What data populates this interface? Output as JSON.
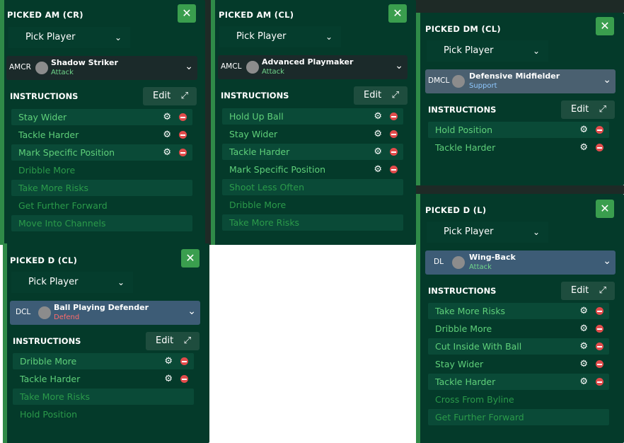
{
  "panels": {
    "amcr": {
      "title": "PICKED AM (CR)",
      "close": "✕",
      "pick": "Pick Player",
      "role": {
        "pos": "AMCR",
        "name": "Shadow Striker",
        "duty": "Attack",
        "duty_color": "#6fd68b",
        "bg": "#1b2a2a"
      },
      "instructions_title": "INSTRUCTIONS",
      "edit": "Edit",
      "rows": [
        {
          "label": "Stay Wider",
          "active": true
        },
        {
          "label": "Tackle Harder",
          "active": true
        },
        {
          "label": "Mark Specific Position",
          "active": true
        },
        {
          "label": "Dribble More",
          "active": false
        },
        {
          "label": "Take More Risks",
          "active": false
        },
        {
          "label": "Get Further Forward",
          "active": false
        },
        {
          "label": "Move Into Channels",
          "active": false
        }
      ]
    },
    "amcl": {
      "title": "PICKED AM (CL)",
      "close": "✕",
      "pick": "Pick Player",
      "role": {
        "pos": "AMCL",
        "name": "Advanced Playmaker",
        "duty": "Attack",
        "duty_color": "#6fd68b",
        "bg": "#1b2a2a"
      },
      "instructions_title": "INSTRUCTIONS",
      "edit": "Edit",
      "rows": [
        {
          "label": "Hold Up Ball",
          "active": true
        },
        {
          "label": "Stay Wider",
          "active": true
        },
        {
          "label": "Tackle Harder",
          "active": true
        },
        {
          "label": "Mark Specific Position",
          "active": true
        },
        {
          "label": "Shoot Less Often",
          "active": false
        },
        {
          "label": "Dribble More",
          "active": false
        },
        {
          "label": "Take More Risks",
          "active": false
        }
      ]
    },
    "dmcl": {
      "title": "PICKED DM (CL)",
      "close": "✕",
      "pick": "Pick Player",
      "role": {
        "pos": "DMCL",
        "name": "Defensive Midfielder",
        "duty": "Support",
        "duty_color": "#8ec8ff",
        "bg": "#4a6070"
      },
      "instructions_title": "INSTRUCTIONS",
      "edit": "Edit",
      "rows": [
        {
          "label": "Hold Position",
          "active": true
        },
        {
          "label": "Tackle Harder",
          "active": true
        }
      ]
    },
    "dcl": {
      "title": "PICKED D (CL)",
      "close": "✕",
      "pick": "Pick Player",
      "role": {
        "pos": "DCL",
        "name": "Ball Playing Defender",
        "duty": "Defend",
        "duty_color": "#ff6b6b",
        "bg": "#3d5c76"
      },
      "instructions_title": "INSTRUCTIONS",
      "edit": "Edit",
      "rows": [
        {
          "label": "Dribble More",
          "active": true
        },
        {
          "label": "Tackle Harder",
          "active": true
        },
        {
          "label": "Take More Risks",
          "active": false
        },
        {
          "label": "Hold Position",
          "active": false
        }
      ]
    },
    "dl": {
      "title": "PICKED D (L)",
      "close": "✕",
      "pick": "Pick Player",
      "role": {
        "pos": "DL",
        "name": "Wing-Back",
        "duty": "Attack",
        "duty_color": "#6fd68b",
        "bg": "#3d5c76"
      },
      "instructions_title": "INSTRUCTIONS",
      "edit": "Edit",
      "rows": [
        {
          "label": "Take More Risks",
          "active": true
        },
        {
          "label": "Dribble More",
          "active": true
        },
        {
          "label": "Cut Inside With Ball",
          "active": true
        },
        {
          "label": "Stay Wider",
          "active": true
        },
        {
          "label": "Tackle Harder",
          "active": true
        },
        {
          "label": "Cross From Byline",
          "active": false
        },
        {
          "label": "Get Further Forward",
          "active": false
        }
      ]
    }
  },
  "icons": {
    "gear": "⚙",
    "chevron": "⌄",
    "expand": "⤢"
  }
}
